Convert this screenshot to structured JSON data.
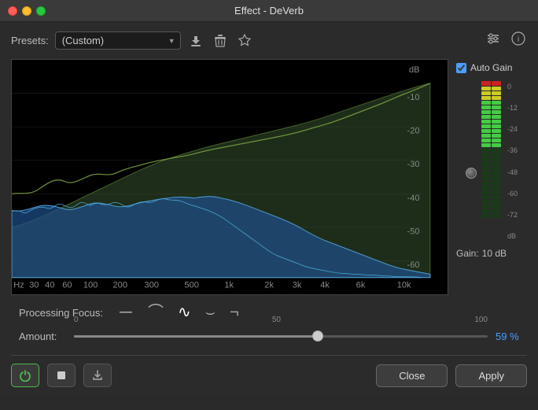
{
  "titleBar": {
    "title": "Effect - DeVerb"
  },
  "presets": {
    "label": "Presets:",
    "value": "(Custom)",
    "placeholder": "(Custom)"
  },
  "icons": {
    "save": "⬇",
    "delete": "🗑",
    "star": "★",
    "settings": "⚙",
    "info": "ℹ"
  },
  "spectrum": {
    "dbLabels": [
      "-10",
      "-20",
      "-30",
      "-40",
      "-50",
      "-60"
    ],
    "dbTopLabel": "dB",
    "freqLabels": [
      "Hz",
      "30",
      "40",
      "60",
      "100",
      "200",
      "300",
      "500",
      "1k",
      "2k",
      "3k",
      "4k",
      "6k",
      "10k"
    ]
  },
  "gainPanel": {
    "autoGainLabel": "Auto Gain",
    "autoGainChecked": true,
    "dbScaleLabels": [
      "0",
      "-12",
      "-24",
      "-36",
      "-48",
      "-60",
      "-72",
      "dB"
    ],
    "gainLabel": "Gain:",
    "gainValue": "10 dB"
  },
  "processingFocus": {
    "label": "Processing Focus:",
    "options": [
      {
        "symbol": "—",
        "title": "flat"
      },
      {
        "symbol": "⌒",
        "title": "low shelf"
      },
      {
        "symbol": "∿",
        "title": "bell"
      },
      {
        "symbol": "⌣",
        "title": "trough"
      },
      {
        "symbol": "⌐",
        "title": "high shelf"
      }
    ]
  },
  "amount": {
    "label": "Amount:",
    "min": "0",
    "mid": "50",
    "max": "100",
    "value": 59,
    "displayValue": "59 %"
  },
  "bottomControls": {
    "powerTitle": "Power",
    "stopTitle": "Stop",
    "exportTitle": "Export"
  },
  "buttons": {
    "close": "Close",
    "apply": "Apply"
  }
}
